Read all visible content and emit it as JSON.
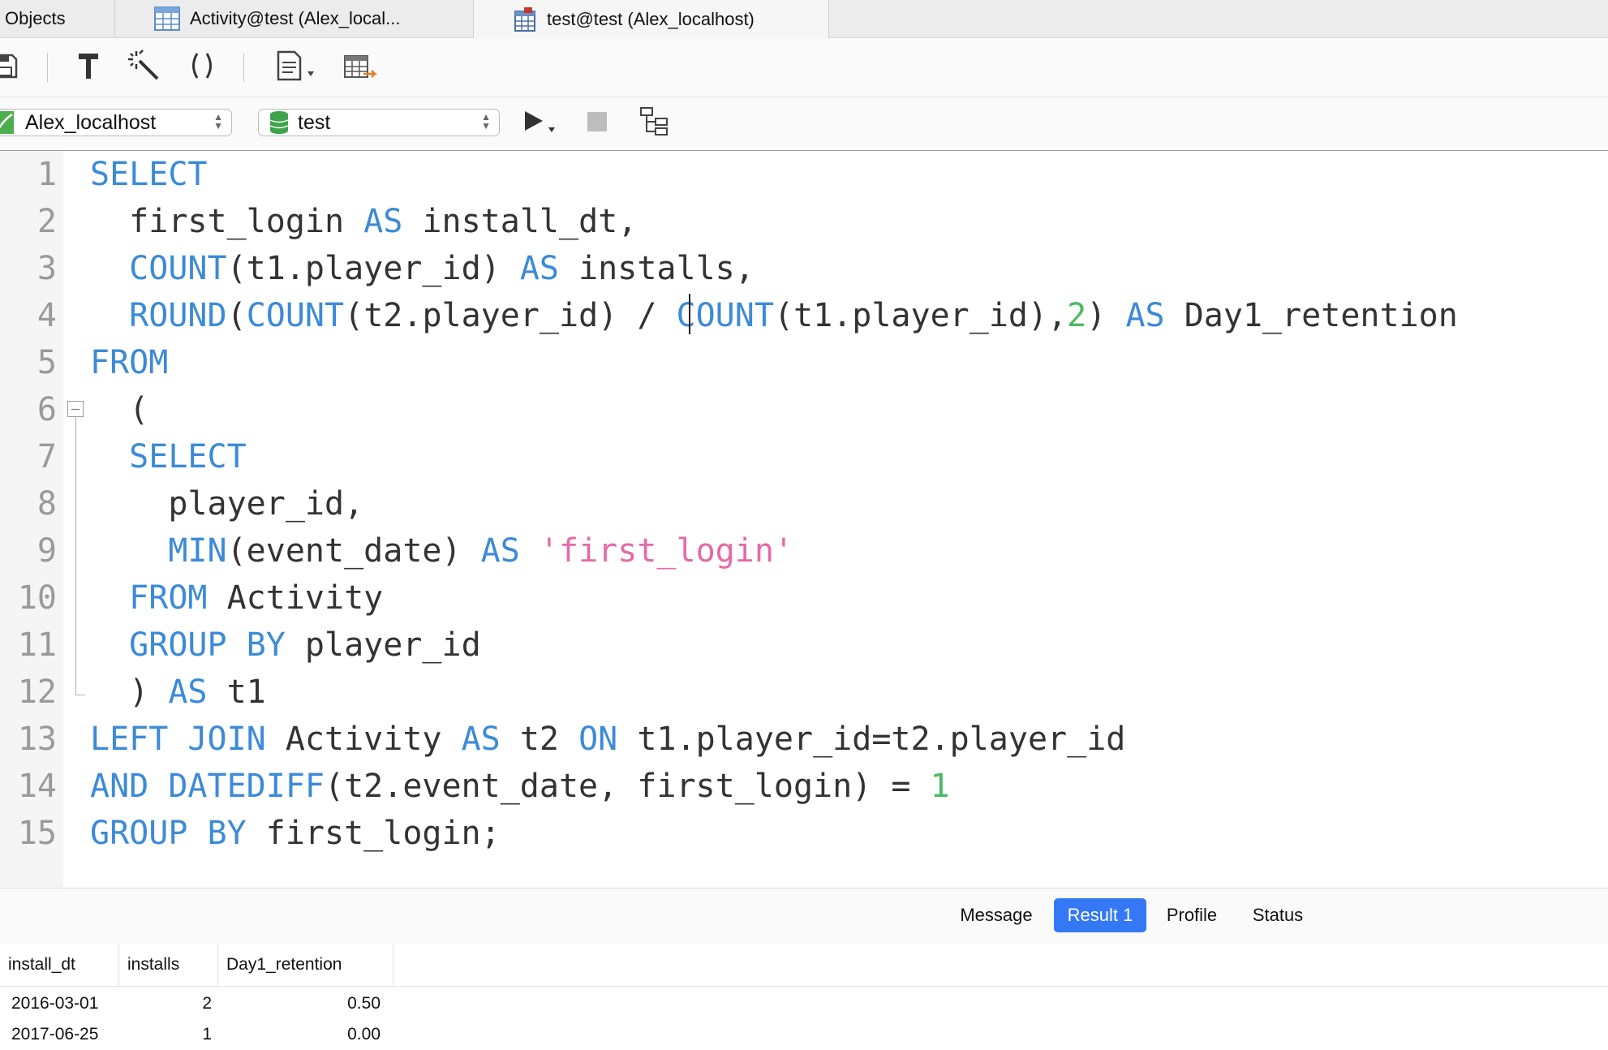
{
  "tabs": [
    {
      "label": "Objects"
    },
    {
      "label": "Activity@test (Alex_local..."
    },
    {
      "label": "test@test (Alex_localhost)"
    }
  ],
  "toolbar": {
    "icons": [
      "save-icon",
      "format-hammer-icon",
      "beautify-wand-icon",
      "parentheses-icon",
      "snippet-document-icon",
      "table-export-icon"
    ]
  },
  "connection": {
    "server": "Alex_localhost",
    "database": "test"
  },
  "editor": {
    "line_numbers": [
      "1",
      "2",
      "3",
      "4",
      "5",
      "6",
      "7",
      "8",
      "9",
      "10",
      "11",
      "12",
      "13",
      "14",
      "15"
    ]
  },
  "result_tabs": {
    "message": "Message",
    "result1": "Result 1",
    "profile": "Profile",
    "status": "Status",
    "active": "Result 1"
  },
  "grid": {
    "columns": [
      "install_dt",
      "installs",
      "Day1_retention"
    ],
    "rows": [
      [
        "2016-03-01",
        "2",
        "0.50"
      ],
      [
        "2017-06-25",
        "1",
        "0.00"
      ]
    ]
  },
  "colors": {
    "keyword": "#3c8ad8",
    "string": "#e56aa6",
    "number": "#4aba62",
    "active_tab": "#3478f6"
  }
}
